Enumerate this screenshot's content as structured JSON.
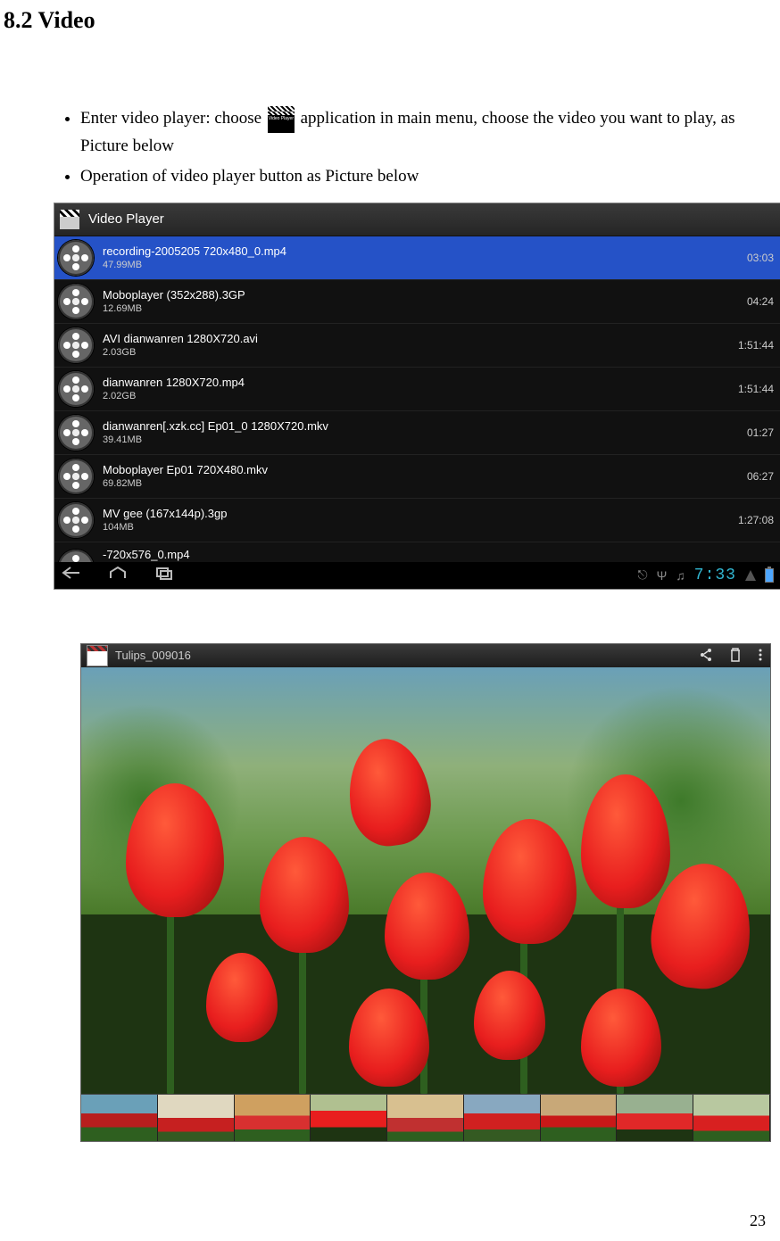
{
  "section": {
    "heading": "8.2 Video",
    "bullets": [
      {
        "prefix": "Enter video player: choose ",
        "suffix": "application in main menu, choose the video you want to play, as Picture below"
      },
      {
        "text": "Operation of video player button as Picture below"
      }
    ]
  },
  "video_list": {
    "app_title": "Video Player",
    "icon_label": "Video Player",
    "rows": [
      {
        "name": "recording-2005205 720x480_0.mp4",
        "size": "47.99MB",
        "duration": "03:03",
        "selected": true
      },
      {
        "name": "Moboplayer  (352x288).3GP",
        "size": "12.69MB",
        "duration": "04:24",
        "selected": false
      },
      {
        "name": "AVI  dianwanren 1280X720.avi",
        "size": "2.03GB",
        "duration": "1:51:44",
        "selected": false
      },
      {
        "name": "dianwanren 1280X720.mp4",
        "size": "2.02GB",
        "duration": "1:51:44",
        "selected": false
      },
      {
        "name": "dianwanren[.xzk.cc]   Ep01_0 1280X720.mkv",
        "size": "39.41MB",
        "duration": "01:27",
        "selected": false
      },
      {
        "name": "Moboplayer  Ep01 720X480.mkv",
        "size": "69.82MB",
        "duration": "06:27",
        "selected": false
      },
      {
        "name": "MV   gee (167x144p).3gp",
        "size": "104MB",
        "duration": "1:27:08",
        "selected": false
      }
    ],
    "partial_row_name": "-720x576_0.mp4",
    "status_bar": {
      "clock": "7:33"
    }
  },
  "playback": {
    "title": "Tulips_009016",
    "top_icons": {
      "share": "share-icon",
      "delete": "trash-icon",
      "menu": "menu-icon"
    },
    "thumb_count": 9
  },
  "page_number": "23"
}
